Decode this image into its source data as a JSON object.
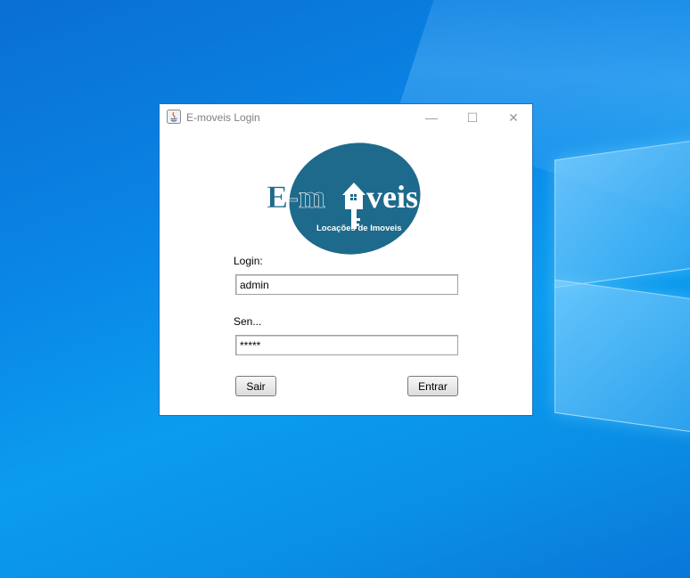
{
  "window": {
    "title": "E-moveis Login",
    "minimize_glyph": "—",
    "maximize_glyph": "☐",
    "close_glyph": "✕",
    "icon": "java-icon"
  },
  "logo": {
    "brand_left": "E-m",
    "brand_right": "veis",
    "tagline": "Locações de Imoveis",
    "accent_color": "#1e6a8c"
  },
  "form": {
    "login_label": "Login:",
    "login_value": "admin",
    "password_label": "Sen...",
    "password_value": "*****"
  },
  "buttons": {
    "exit_label": "Sair",
    "enter_label": "Entrar"
  }
}
